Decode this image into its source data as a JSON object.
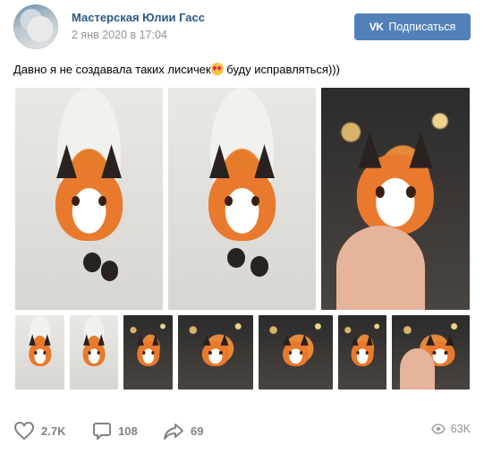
{
  "post": {
    "author": "Мастерская Юлии Гасс",
    "date": "2 янв 2020 в 17:04",
    "subscribe_label": "Подписаться",
    "vk_logo": "VK",
    "text_before": "Давно я не создавала таких лисичек",
    "text_after": " буду исправляться)))"
  },
  "icons": {
    "avatar": "avatar",
    "subscribe": "vk-logo-icon",
    "likes": "heart-icon",
    "comments": "comment-icon",
    "shares": "share-icon",
    "views": "eye-icon"
  },
  "stats": {
    "likes": "2.7K",
    "comments": "108",
    "shares": "69",
    "views": "63K"
  },
  "colors": {
    "accent": "#5181b8",
    "author": "#2a5885",
    "muted": "#939393"
  }
}
